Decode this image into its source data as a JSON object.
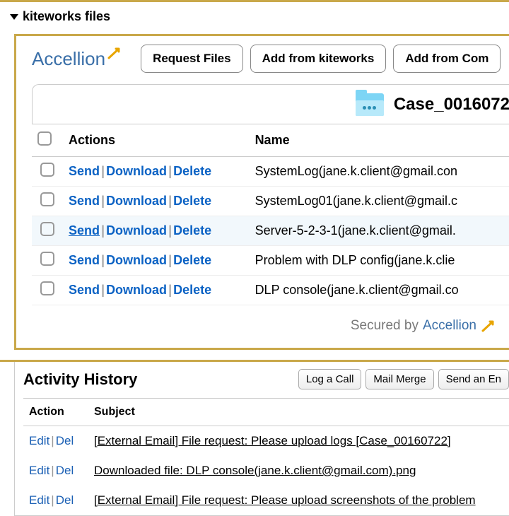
{
  "section_title": "kiteworks files",
  "brand": "Accellion",
  "toolbar": {
    "request_files": "Request Files",
    "add_kiteworks": "Add from kiteworks",
    "add_computer": "Add from Com"
  },
  "folder_name": "Case_0016072",
  "table": {
    "headers": {
      "actions": "Actions",
      "name": "Name"
    },
    "action_labels": {
      "send": "Send",
      "download": "Download",
      "delete": "Delete"
    },
    "rows": [
      {
        "name": "SystemLog(jane.k.client@gmail.con",
        "hl": false,
        "underline_send": false
      },
      {
        "name": "SystemLog01(jane.k.client@gmail.c",
        "hl": false,
        "underline_send": false
      },
      {
        "name": "Server-5-2-3-1(jane.k.client@gmail.",
        "hl": true,
        "underline_send": true
      },
      {
        "name": "Problem with DLP config(jane.k.clie",
        "hl": false,
        "underline_send": false
      },
      {
        "name": "DLP console(jane.k.client@gmail.co",
        "hl": false,
        "underline_send": false
      }
    ]
  },
  "secured_prefix": "Secured by",
  "history": {
    "title": "Activity History",
    "buttons": {
      "log_call": "Log a Call",
      "mail_merge": "Mail Merge",
      "send_email": "Send an En"
    },
    "headers": {
      "action": "Action",
      "subject": "Subject"
    },
    "action_labels": {
      "edit": "Edit",
      "del": "Del"
    },
    "rows": [
      {
        "subject": "[External Email] File request: Please upload logs [Case_00160722]"
      },
      {
        "subject": "Downloaded file: DLP console(jane.k.client@gmail.com).png"
      },
      {
        "subject": "[External Email] File request: Please upload screenshots of the problem"
      }
    ]
  }
}
